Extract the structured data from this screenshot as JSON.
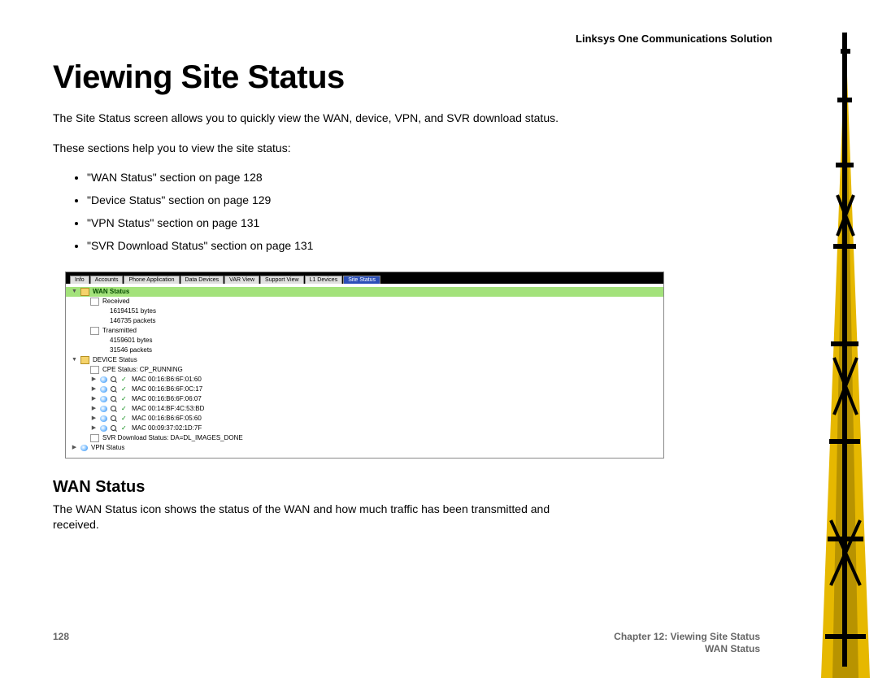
{
  "header": {
    "product": "Linksys One Communications Solution"
  },
  "page": {
    "title": "Viewing Site Status",
    "intro": "The Site Status screen allows you to quickly view the WAN, device, VPN, and SVR download status.",
    "sections_intro": "These sections help you to view the site status:",
    "sections": [
      "\"WAN Status\" section on page 128",
      "\"Device Status\" section on page 129",
      "\"VPN Status\" section on page 131",
      "\"SVR Download Status\" section on page 131"
    ],
    "wan_heading": "WAN Status",
    "wan_para": "The WAN Status icon shows the status of the WAN and how much traffic has been transmitted and received."
  },
  "screenshot": {
    "tabs": [
      "Info",
      "Accounts",
      "Phone Application",
      "Data Devices",
      "VAR View",
      "Support View",
      "L1 Devices",
      "Site Status"
    ],
    "active_tab_index": 7,
    "wan": {
      "label": "WAN Status",
      "received_label": "Received",
      "received_bytes": "16194151 bytes",
      "received_packets": "146735 packets",
      "transmitted_label": "Transmitted",
      "transmitted_bytes": "4159601 bytes",
      "transmitted_packets": "31546 packets"
    },
    "device": {
      "label": "DEVICE Status",
      "cpe": "CPE Status: CP_RUNNING",
      "macs": [
        "MAC 00:16:B6:6F:01:60",
        "MAC 00:16:B6:6F:0C:17",
        "MAC 00:16:B6:6F:06:07",
        "MAC 00:14:BF:4C:53:BD",
        "MAC 00:16:B6:6F:05:60",
        "MAC 00:09:37:02:1D:7F"
      ],
      "svr": "SVR Download Status: DA=DL_IMAGES_DONE"
    },
    "vpn_label": "VPN Status"
  },
  "footer": {
    "page_number": "128",
    "chapter": "Chapter 12: Viewing Site Status",
    "subsection": "WAN Status"
  }
}
